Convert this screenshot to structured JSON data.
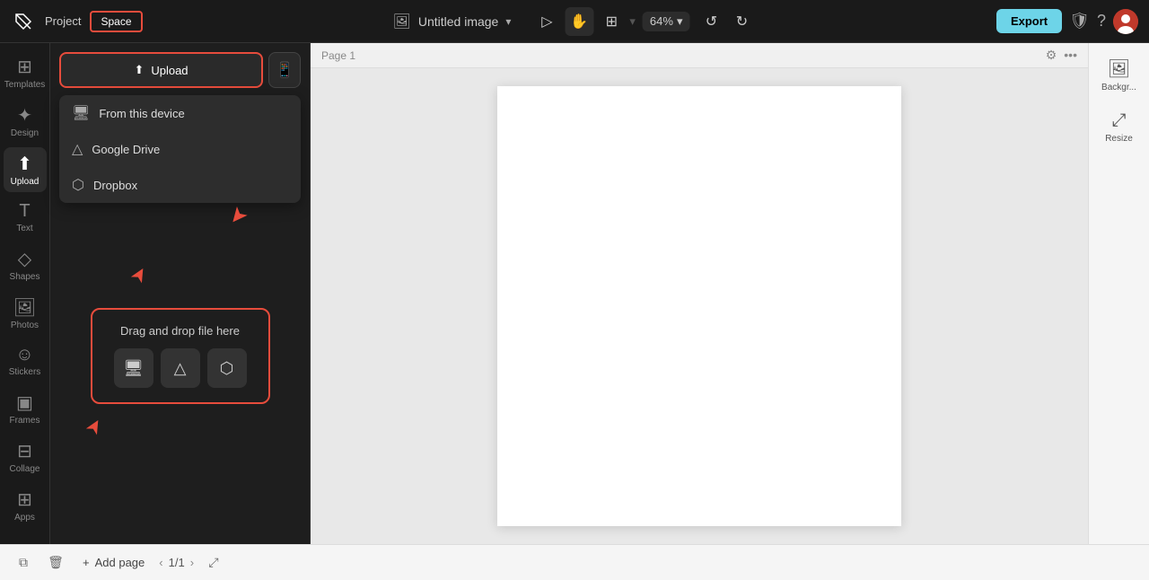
{
  "topbar": {
    "project_label": "Project",
    "space_btn": "Space",
    "doc_title": "Untitled image",
    "zoom_level": "64%",
    "export_btn": "Export"
  },
  "sidebar": {
    "items": [
      {
        "label": "Templates",
        "icon": "⊞"
      },
      {
        "label": "Design",
        "icon": "✦"
      },
      {
        "label": "Upload",
        "icon": "↑",
        "active": true
      },
      {
        "label": "Text",
        "icon": "T"
      },
      {
        "label": "Shapes",
        "icon": "◇"
      },
      {
        "label": "Photos",
        "icon": "🖼"
      },
      {
        "label": "Stickers",
        "icon": "☺"
      },
      {
        "label": "Frames",
        "icon": "▣"
      },
      {
        "label": "Collage",
        "icon": "⊟"
      },
      {
        "label": "Apps",
        "icon": "⊞"
      }
    ]
  },
  "upload_panel": {
    "upload_btn_label": "Upload",
    "dropdown": {
      "items": [
        {
          "label": "From this device",
          "icon": "🖥"
        },
        {
          "label": "Google Drive",
          "icon": "△"
        },
        {
          "label": "Dropbox",
          "icon": "⬡"
        }
      ]
    },
    "dnd_label": "Drag and drop file here",
    "dnd_icons": [
      "🖥",
      "☁",
      "⬡"
    ]
  },
  "canvas": {
    "page_label": "Page 1"
  },
  "right_panel": {
    "items": [
      {
        "label": "Backgr...",
        "icon": "🖼"
      },
      {
        "label": "Resize",
        "icon": "⤢"
      }
    ]
  },
  "bottom_bar": {
    "add_page_label": "Add page",
    "page_indicator": "1/1"
  }
}
